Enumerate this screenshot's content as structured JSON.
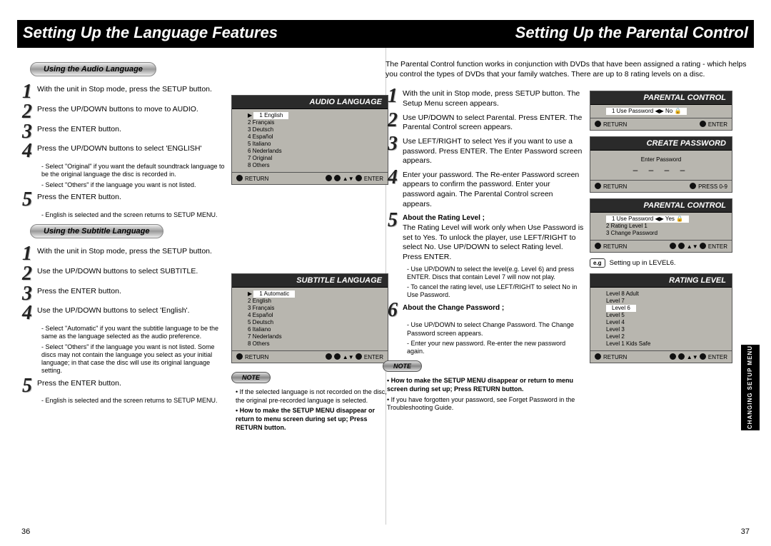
{
  "left": {
    "title": "Setting Up the Language Features",
    "section1": {
      "pill": "Using the Audio Language",
      "steps": [
        "With the unit in Stop mode, press the SETUP button.",
        "Press the UP/DOWN buttons to move to AUDIO.",
        "Press the ENTER button.",
        "Press the UP/DOWN buttons to select 'ENGLISH'",
        "Press the ENTER button."
      ],
      "subs4": [
        "Select \"Original\" if you want the default soundtrack language to be the original language the disc is recorded in.",
        "Select \"Others\" if the language you want is not listed."
      ],
      "subs5": [
        "English is selected and the screen returns to SETUP MENU."
      ]
    },
    "section2": {
      "pill": "Using the Subtitle Language",
      "steps": [
        "With the unit in Stop mode, press the SETUP button.",
        "Use the UP/DOWN buttons to select SUBTITLE.",
        "Press the ENTER button.",
        "Use the UP/DOWN buttons to select 'English'.",
        "Press the ENTER button."
      ],
      "subs4": [
        "Select \"Automatic\" if you want the subtitle language to be the same as the language selected as the audio preference.",
        "Select \"Others\" if the language you want is not listed. Some discs may not contain the language you select as your initial language; in that case the disc will use its original language setting."
      ],
      "subs5": [
        "English is selected and the screen returns to SETUP MENU."
      ]
    },
    "osd1": {
      "head": "AUDIO LANGUAGE",
      "rows": [
        "1  English",
        "2  Français",
        "3  Deutsch",
        "4  Español",
        "5  Italiano",
        "6  Nederlands",
        "7  Original",
        "8  Others"
      ],
      "return": "RETURN",
      "enter": "ENTER"
    },
    "osd2": {
      "head": "SUBTITLE LANGUAGE",
      "rows": [
        "1  Automatic",
        "2  English",
        "3  Français",
        "4  Español",
        "5  Deutsch",
        "6  Italiano",
        "7  Nederlands",
        "8  Others"
      ],
      "return": "RETURN",
      "enter": "ENTER"
    },
    "note_label": "NOTE",
    "notes": [
      "If the selected language is not recorded on the disc, the original pre-recorded language is selected.",
      "How to make the SETUP MENU disappear or return to menu screen during set up; Press RETURN button."
    ],
    "pagenum": "36"
  },
  "right": {
    "title": "Setting Up the Parental Control",
    "intro": "The Parental Control function works in conjunction with DVDs that have been assigned a rating - which helps you control the types of DVDs that your family watches. There are up to 8 rating levels on a disc.",
    "steps": [
      "With the unit in Stop mode, press SETUP button. The Setup Menu screen appears.",
      "Use UP/DOWN to select Parental. Press ENTER. The Parental Control screen appears.",
      "Use LEFT/RIGHT to select Yes if you want to use a password. Press ENTER. The Enter Password screen appears.",
      "Enter your password. The Re-enter Password screen appears to confirm the password. Enter your password again. The Parental Control screen appears."
    ],
    "step5head": "About the Rating Level ;",
    "step5body": "The Rating Level will work only when Use Password is set to Yes. To unlock the player, use LEFT/RIGHT to select No. Use UP/DOWN to select Rating level. Press ENTER.",
    "subs5": [
      "Use UP/DOWN to select the level(e.g. Level 6) and press ENTER. Discs that contain Level 7 will now not play.",
      "To cancel the rating level, use LEFT/RIGHT to select No in Use Password."
    ],
    "step6head": "About the Change Password ;",
    "subs6": [
      "Use UP/DOWN to select Change Password. The Change Password screen appears.",
      "Enter your new password. Re-enter the new password again."
    ],
    "note_label": "NOTE",
    "notes": [
      "How to make the SETUP MENU disappear or return to menu screen during set up; Press RETURN button.",
      "If you have forgotten your password, see Forget Password in the Troubleshooting Guide."
    ],
    "osd_pc1": {
      "head": "PARENTAL CONTROL",
      "row": "1   Use Password   ◀▶  No",
      "return": "RETURN",
      "enter": "ENTER"
    },
    "osd_cp": {
      "head": "CREATE PASSWORD",
      "label": "Enter Password",
      "dashes": "‒ ‒ ‒ ‒",
      "return": "RETURN",
      "press": "PRESS 0-9"
    },
    "osd_pc2": {
      "head": "PARENTAL CONTROL",
      "rows": [
        "1   Use Password   ◀▶ Yes",
        "2   Rating Level          1",
        "3   Change Password"
      ],
      "return": "RETURN",
      "enter": "ENTER"
    },
    "eg_label": "e.g",
    "eg_text": "Setting up in LEVEL6.",
    "osd_rl": {
      "head": "RATING LEVEL",
      "rows": [
        "Level 8 Adult",
        "Level 7",
        "Level 6",
        "Level 5",
        "Level 4",
        "Level 3",
        "Level 2",
        "Level 1 Kids Safe"
      ],
      "return": "RETURN",
      "enter": "ENTER"
    },
    "tab": "CHANGING\nSETUP MENU",
    "pagenum": "37"
  }
}
